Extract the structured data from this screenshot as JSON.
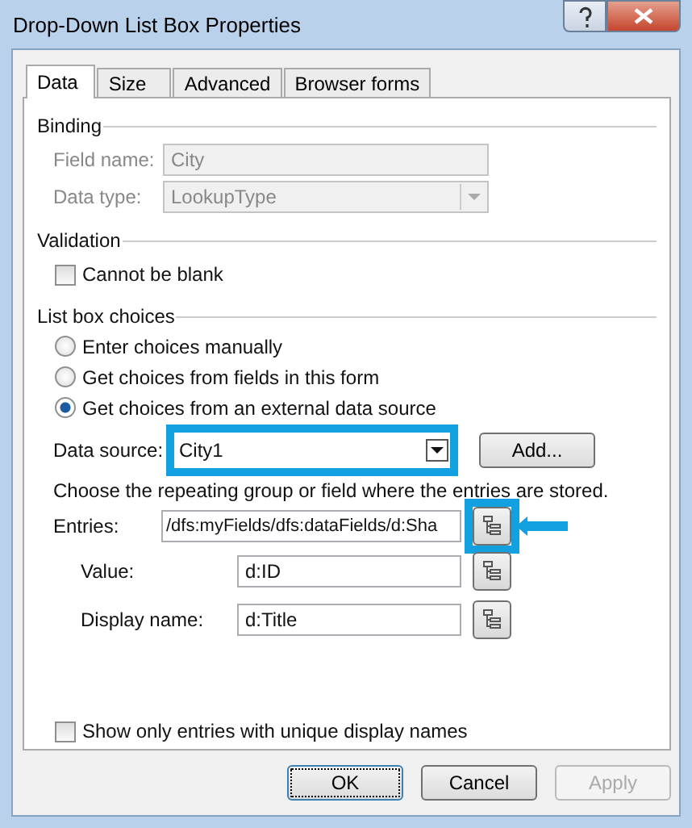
{
  "window": {
    "title": "Drop-Down List Box Properties"
  },
  "tabs": [
    {
      "label": "Data",
      "selected": true
    },
    {
      "label": "Size",
      "selected": false
    },
    {
      "label": "Advanced",
      "selected": false
    },
    {
      "label": "Browser forms",
      "selected": false
    }
  ],
  "binding": {
    "label": "Binding",
    "fields": [
      {
        "kind": "text",
        "label": "Field name:",
        "value": "City",
        "disabled": true
      },
      {
        "kind": "dropdown",
        "label": "Data type:",
        "value": "LookupType",
        "disabled": true
      }
    ]
  },
  "validation": {
    "label": "Validation",
    "checkboxes": [
      {
        "label": "Cannot be blank",
        "checked": false
      }
    ]
  },
  "list_box_choices": {
    "label": "List box choices",
    "radios": [
      {
        "label": "Enter choices manually",
        "selected": false
      },
      {
        "label": "Get choices from fields in this form",
        "selected": false
      },
      {
        "label": "Get choices from an external data source",
        "selected": true
      }
    ],
    "data_source": {
      "label": "Data source:",
      "value": "City1",
      "highlighted": true
    },
    "add_button": "Add...",
    "hint": "Choose the repeating group or field where the entries are stored.",
    "entries": {
      "label": "Entries:",
      "value": "/dfs:myFields/dfs:dataFields/d:Sha",
      "highlighted": true
    },
    "sub_fields": [
      {
        "label": "Value:",
        "value": "d:ID"
      },
      {
        "label": "Display name:",
        "value": "d:Title"
      }
    ]
  },
  "unique_checkbox": {
    "label": "Show only entries with unique display names",
    "checked": false
  },
  "buttons": [
    {
      "label": "OK",
      "default": true,
      "disabled": false
    },
    {
      "label": "Cancel",
      "default": false,
      "disabled": false
    },
    {
      "label": "Apply",
      "default": false,
      "disabled": true
    }
  ]
}
